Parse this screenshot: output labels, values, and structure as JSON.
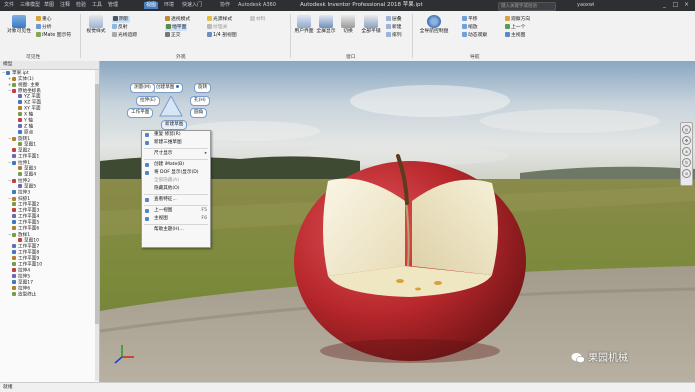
{
  "titlebar": {
    "tabs": [
      "文件",
      "三维模型",
      "草图",
      "注释",
      "检验",
      "工具",
      "管理",
      "视图",
      "环境",
      "快速入门",
      "协作",
      "Autodesk A360"
    ],
    "active_tab": 7,
    "title": "Autodesk Inventor Professional 2018   苹果.ipt",
    "search_placeholder": "键入关键字或短语",
    "user": "yaoxwl",
    "window_controls": [
      "_",
      "□",
      "×"
    ]
  },
  "ribbon": {
    "groups": {
      "visibility": "可见性",
      "appearance": "外观",
      "windows": "窗口",
      "navigate": "导航"
    },
    "visibility": {
      "object_visibility": "对象可见性",
      "center_of_gravity": "重心",
      "analysis": "分析",
      "ixmate": "iMate 图示符"
    },
    "appearance": {
      "view_style": "视觉样式",
      "shadows": "阴影",
      "reflection": "反射",
      "ground_plane": "地平面",
      "perspective": "透视模式",
      "orthographic": "正交",
      "ray_tracing": "光线追踪",
      "half_section": "1/4 剖视图",
      "lighting": "光源样式",
      "texture_off": "纹理关",
      "material": "材料",
      "scene_preset": "全部剖切",
      "global_lighting": "全局照明"
    },
    "windows": {
      "user_interface": "用户界面",
      "full_screen": "全屏显示",
      "switch": "切换",
      "tile": "全部平铺",
      "cascade": "层叠",
      "new": "新建",
      "arrange": "排列"
    },
    "nav": {
      "full_nav_wheel": "全导航控制盘",
      "pan": "平移",
      "zoom": "缩放",
      "orbit": "动态观察",
      "look_at": "观察方向",
      "previous": "上一个",
      "home_view": "主视图"
    }
  },
  "sidebar": {
    "header": "模型",
    "tree": [
      {
        "label": "苹果.ipt",
        "level": 0,
        "expand": "−"
      },
      {
        "label": "实体(1)",
        "level": 1,
        "expand": "+"
      },
      {
        "label": "视图: 主要",
        "level": 1,
        "expand": "+"
      },
      {
        "label": "原始坐标系",
        "level": 1,
        "expand": "−"
      },
      {
        "label": "YZ 平面",
        "level": 2,
        "expand": ""
      },
      {
        "label": "XZ 平面",
        "level": 2,
        "expand": ""
      },
      {
        "label": "XY 平面",
        "level": 2,
        "expand": ""
      },
      {
        "label": "X 轴",
        "level": 2,
        "expand": ""
      },
      {
        "label": "Y 轴",
        "level": 2,
        "expand": ""
      },
      {
        "label": "Z 轴",
        "level": 2,
        "expand": ""
      },
      {
        "label": "原点",
        "level": 2,
        "expand": ""
      },
      {
        "label": "旋转1",
        "level": 1,
        "expand": "−"
      },
      {
        "label": "草图1",
        "level": 2,
        "expand": ""
      },
      {
        "label": "草图2",
        "level": 1,
        "expand": ""
      },
      {
        "label": "工作平面1",
        "level": 1,
        "expand": ""
      },
      {
        "label": "拉伸1",
        "level": 1,
        "expand": "−"
      },
      {
        "label": "草图3",
        "level": 2,
        "expand": ""
      },
      {
        "label": "草图4",
        "level": 2,
        "expand": ""
      },
      {
        "label": "拉伸2",
        "level": 1,
        "expand": "−"
      },
      {
        "label": "草图5",
        "level": 2,
        "expand": ""
      },
      {
        "label": "拉伸3",
        "level": 1,
        "expand": ""
      },
      {
        "label": "扫掠1",
        "level": 1,
        "expand": "−"
      },
      {
        "label": "工作平面2",
        "level": 1,
        "expand": ""
      },
      {
        "label": "工作平面3",
        "level": 1,
        "expand": ""
      },
      {
        "label": "工作平面4",
        "level": 1,
        "expand": ""
      },
      {
        "label": "工作平面5",
        "level": 1,
        "expand": ""
      },
      {
        "label": "工作平面6",
        "level": 1,
        "expand": ""
      },
      {
        "label": "放样1",
        "level": 1,
        "expand": "−"
      },
      {
        "label": "草图10",
        "level": 2,
        "expand": ""
      },
      {
        "label": "工作平面7",
        "level": 1,
        "expand": ""
      },
      {
        "label": "工作平面8",
        "level": 1,
        "expand": ""
      },
      {
        "label": "工作平面9",
        "level": 1,
        "expand": ""
      },
      {
        "label": "工作平面10",
        "level": 1,
        "expand": ""
      },
      {
        "label": "拉伸4",
        "level": 1,
        "expand": ""
      },
      {
        "label": "拉伸5",
        "level": 1,
        "expand": ""
      },
      {
        "label": "草图17",
        "level": 1,
        "expand": ""
      },
      {
        "label": "拉伸6",
        "level": 1,
        "expand": ""
      },
      {
        "label": "造型终止",
        "level": 1,
        "expand": ""
      }
    ]
  },
  "marking_menu": {
    "top": "创建草图",
    "left_upper": "测量(M)",
    "left_mid": "拉伸(E)",
    "left_lower": "工作平面",
    "right_upper": "旋转",
    "right_mid": "孔(H)",
    "right_lower": "圆角",
    "bottom": "新建草图"
  },
  "context_menu": [
    {
      "label": "重复 修剪(R)",
      "shortcut": "",
      "disabled": false,
      "icon": "repeat-icon"
    },
    {
      "label": "新建三维草图",
      "shortcut": "",
      "disabled": false,
      "icon": "sketch3d-icon"
    },
    {
      "label": "尺寸显示",
      "shortcut": "▸",
      "disabled": false,
      "icon": ""
    },
    {
      "label": "创建 iMate(B)",
      "shortcut": "",
      "disabled": false,
      "icon": "imate-icon"
    },
    {
      "label": "将 DOF 显示(显示(D)",
      "shortcut": "",
      "disabled": false,
      "icon": "dof-icon"
    },
    {
      "label": "全部隐藏(A)",
      "shortcut": "",
      "disabled": true,
      "icon": ""
    },
    {
      "label": "隐藏其他(O)",
      "shortcut": "",
      "disabled": false,
      "icon": ""
    },
    {
      "label": "查看特征...",
      "shortcut": "",
      "disabled": false,
      "icon": "feature-icon"
    },
    {
      "label": "上一视图",
      "shortcut": "F5",
      "disabled": false,
      "icon": "prev-view-icon"
    },
    {
      "label": "主视图",
      "shortcut": "F6",
      "disabled": false,
      "icon": "home-icon"
    },
    {
      "label": "帮助主题(H)...",
      "shortcut": "",
      "disabled": false,
      "icon": ""
    }
  ],
  "viewcube_label": "前 右",
  "statusbar": {
    "text": "就绪"
  },
  "watermark": "果园机械",
  "colors": {
    "ribbon_active": "#4a7fbf",
    "titlebar": "#2d2f33",
    "apple_red": "#b7272b",
    "apple_flesh": "#f2ead0"
  }
}
